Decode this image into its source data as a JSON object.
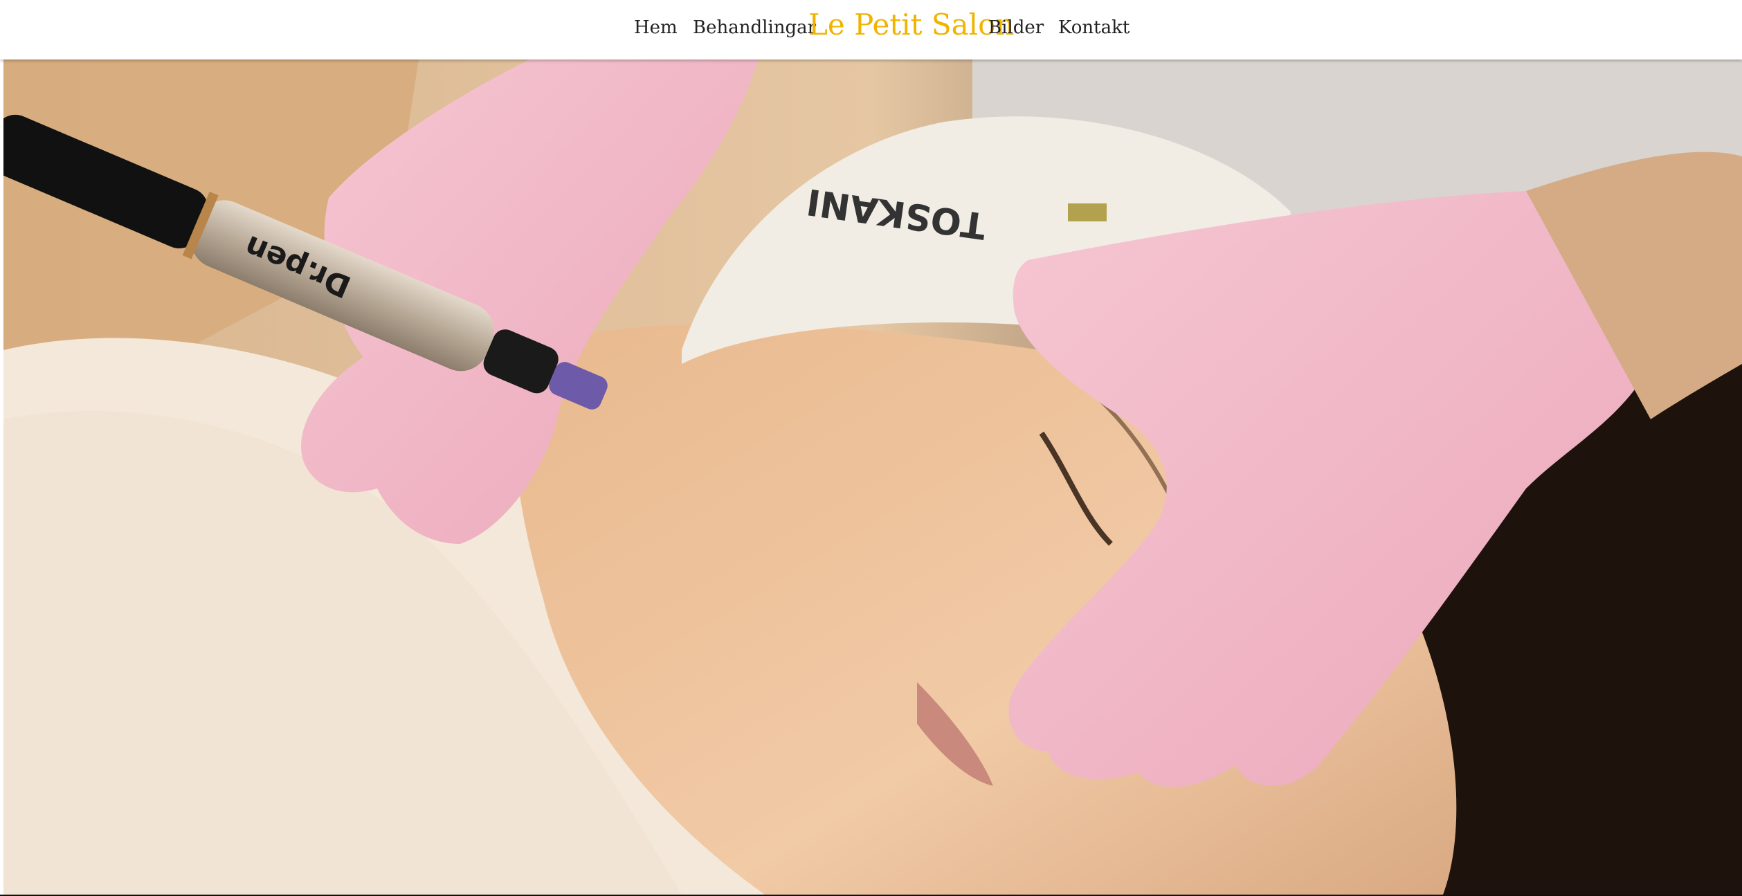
{
  "nav": {
    "items": [
      {
        "label": "Hem"
      },
      {
        "label": "Behandlingar"
      },
      {
        "label": "Bilder"
      },
      {
        "label": "Kontakt"
      }
    ],
    "logo": "Le Petit Salon"
  },
  "hero": {
    "headband_text": "TOSKANI",
    "pen_text": "Dr.pen"
  },
  "colors": {
    "accent": "#f0b400",
    "nav_text": "#222222",
    "glove": "#f2b6c6"
  }
}
